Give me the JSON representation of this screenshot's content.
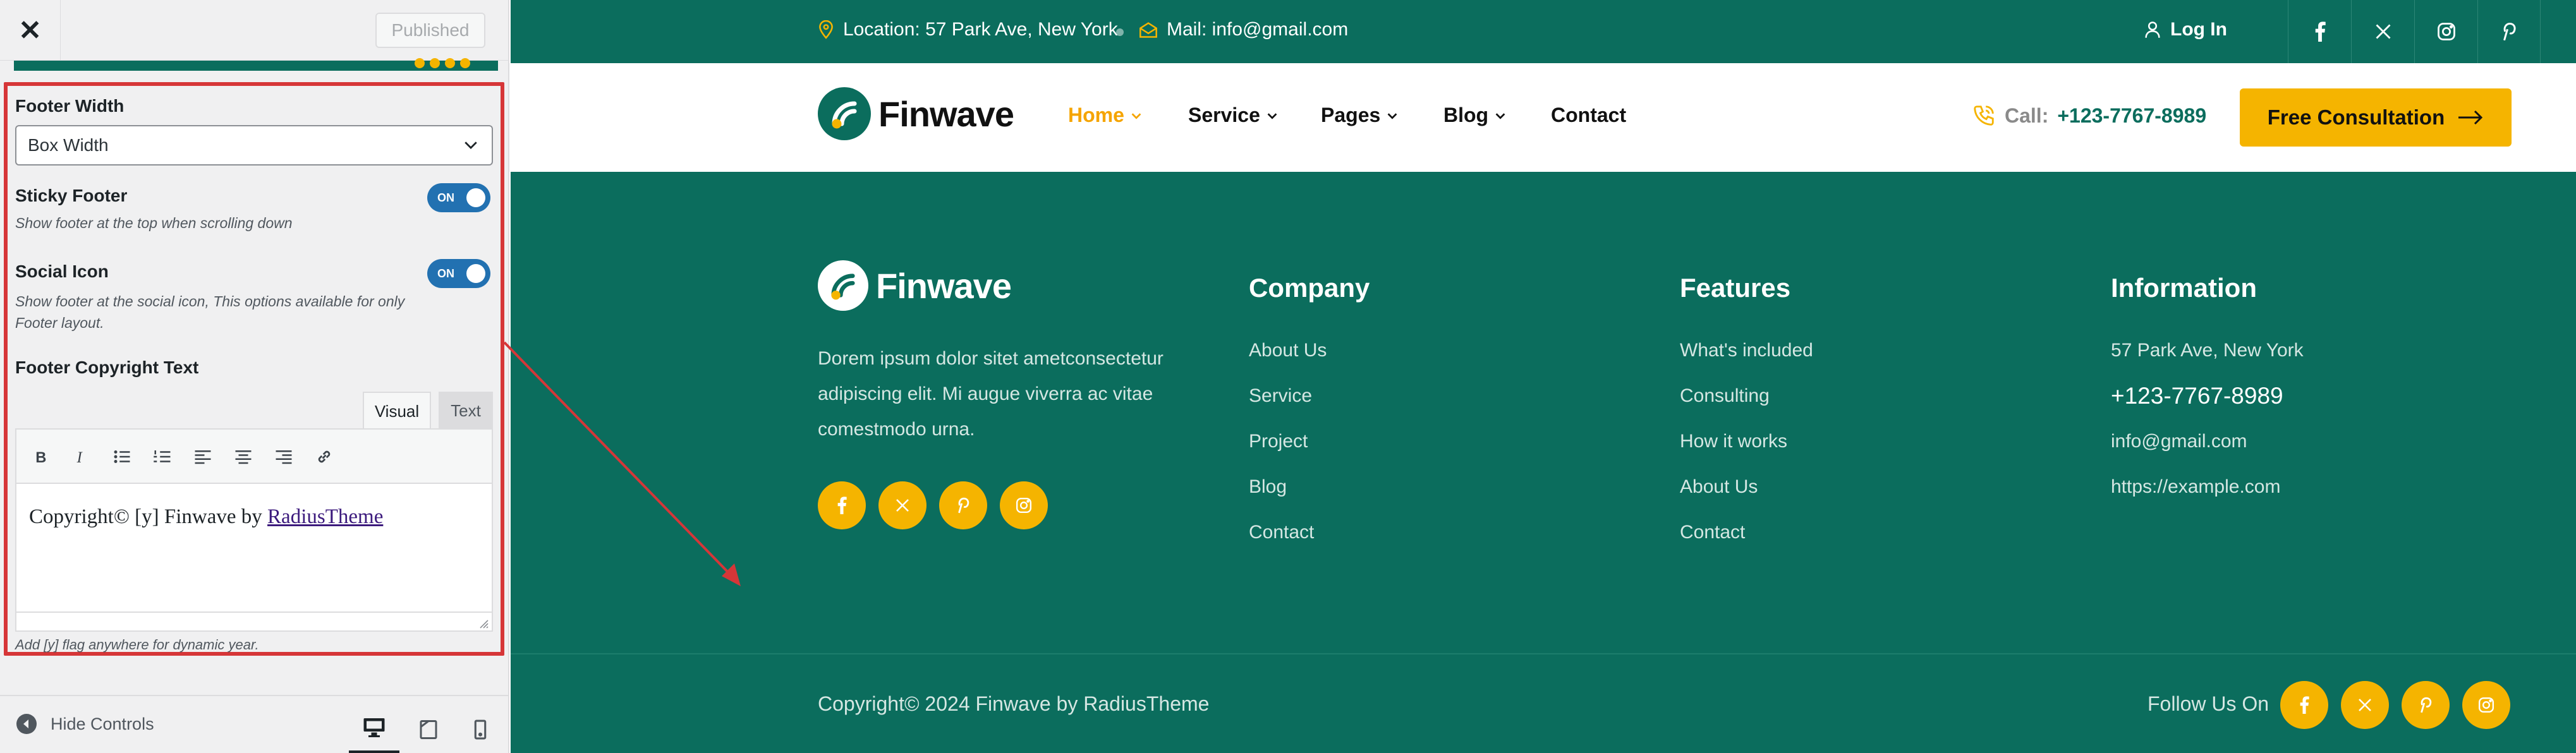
{
  "customizer": {
    "close_label": "✕",
    "published_label": "Published",
    "footer_width": {
      "label": "Footer Width",
      "value": "Box Width"
    },
    "sticky_footer": {
      "label": "Sticky Footer",
      "description": "Show footer at the top when scrolling down",
      "toggle": "ON"
    },
    "social_icon": {
      "label": "Social Icon",
      "description_line1": "Show footer at the social icon, This options available for only",
      "description_line2": "Footer layout.",
      "toggle": "ON"
    },
    "copyright_text": {
      "label": "Footer Copyright Text",
      "tab_visual": "Visual",
      "tab_text": "Text",
      "content_prefix": "Copyright© [y] Finwave by",
      "content_link": "RadiusTheme",
      "help": "Add [y] flag anywhere for dynamic year."
    },
    "toolbar_icons": [
      "bold-icon",
      "italic-icon",
      "bullet-list-icon",
      "numbered-list-icon",
      "align-left-icon",
      "align-center-icon",
      "align-right-icon",
      "link-icon"
    ],
    "footer": {
      "hide_controls": "Hide Controls",
      "devices": [
        "desktop-icon",
        "tablet-icon",
        "mobile-icon"
      ],
      "active_device": "desktop"
    }
  },
  "site": {
    "colors": {
      "primary": "#0b6d5d",
      "accent": "#f5b400",
      "highlight": "#d63638"
    },
    "topbar": {
      "location": "Location: 57 Park Ave, New York",
      "mail": "Mail: info@gmail.com",
      "login": "Log In",
      "social_icons": [
        "facebook-icon",
        "x-icon",
        "instagram-icon",
        "pinterest-icon"
      ]
    },
    "navbar": {
      "logo": "Finwave",
      "items": [
        "Home",
        "Service",
        "Pages",
        "Blog",
        "Contact"
      ],
      "active": "Home",
      "call_label": "Call:",
      "call_number": "+123-7767-8989",
      "cta": "Free Consultation"
    },
    "footer": {
      "logo": "Finwave",
      "about_line1": "Dorem ipsum dolor sitet ametconsectetur",
      "about_line2": "adipiscing elit. Mi augue viverra ac vitae",
      "about_line3": "comestmodo urna.",
      "company": {
        "title": "Company",
        "links": [
          "About Us",
          "Service",
          "Project",
          "Blog",
          "Contact"
        ]
      },
      "features": {
        "title": "Features",
        "links": [
          "What's included",
          "Consulting",
          "How it works",
          "About Us",
          "Contact"
        ]
      },
      "information": {
        "title": "Information",
        "address": "57 Park Ave, New York",
        "phone": "+123-7767-8989",
        "email": "info@gmail.com",
        "website": "https://example.com"
      },
      "copyright": "Copyright© 2024 Finwave by RadiusTheme",
      "follow_label": "Follow Us On",
      "social_icons": [
        "facebook-icon",
        "x-icon",
        "pinterest-icon",
        "instagram-icon"
      ]
    }
  }
}
